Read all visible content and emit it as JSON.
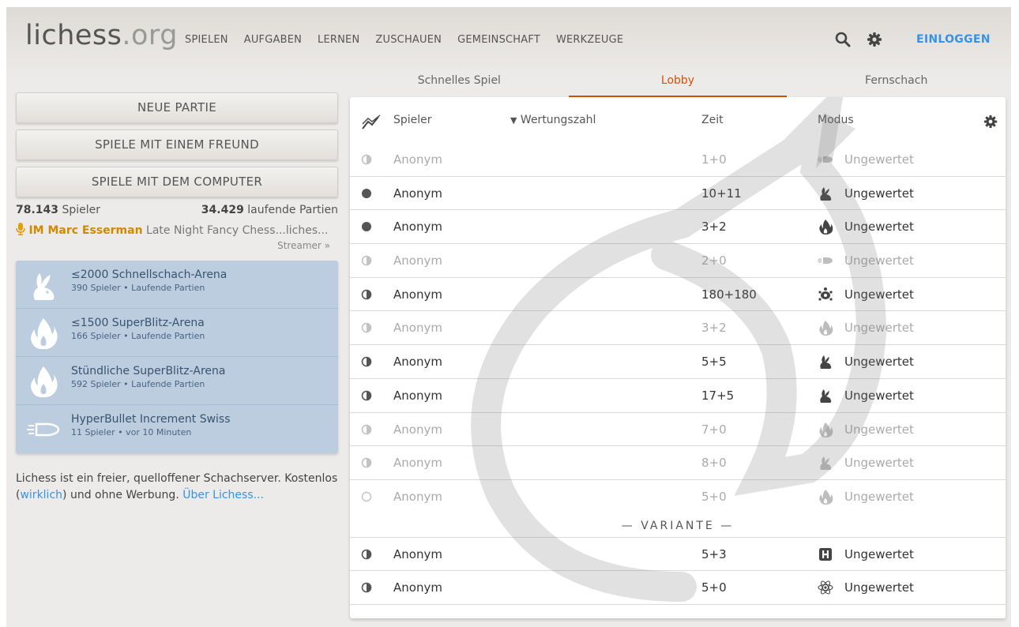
{
  "header": {
    "logo_main": "lichess",
    "logo_tld": ".org",
    "nav": [
      "SPIELEN",
      "AUFGABEN",
      "LERNEN",
      "ZUSCHAUEN",
      "GEMEINSCHAFT",
      "WERKZEUGE"
    ],
    "login": "EINLOGGEN",
    "accent_color": "#3692e7"
  },
  "tabs": [
    {
      "label": "Schnelles Spiel",
      "active": false
    },
    {
      "label": "Lobby",
      "active": true
    },
    {
      "label": "Fernschach",
      "active": false
    }
  ],
  "left": {
    "buttons": [
      "NEUE PARTIE",
      "SPIELE MIT EINEM FREUND",
      "SPIELE MIT DEM COMPUTER"
    ],
    "players_count": "78.143",
    "players_label": "Spieler",
    "games_count": "34.429",
    "games_label": "laufende Partien",
    "streamer_name": "IM Marc Esserman",
    "streamer_title": "Late Night Fancy Chess...liches...",
    "streamer_link": "Streamer »",
    "tournaments": [
      {
        "name": "≤2000 Schnellschach-Arena",
        "sub": "390 Spieler • Laufende Partien",
        "icon": "rabbit-icon"
      },
      {
        "name": "≤1500 SuperBlitz-Arena",
        "sub": "166 Spieler • Laufende Partien",
        "icon": "flame-icon"
      },
      {
        "name": "Stündliche SuperBlitz-Arena",
        "sub": "592 Spieler • Laufende Partien",
        "icon": "flame-icon"
      },
      {
        "name": "HyperBullet Increment Swiss",
        "sub": "11 Spieler •  vor 10 Minuten",
        "icon": "bullet-icon"
      }
    ],
    "about_text": "Lichess ist ein freier, quelloffener Schachserver. Kostenlos (",
    "about_link1": "wirklich",
    "about_text2": ") und ohne Werbung. ",
    "about_link2": "Über Lichess..."
  },
  "lobby": {
    "columns": {
      "player": "Spieler",
      "rating": "Wertungszahl",
      "time": "Zeit",
      "mode": "Modus"
    },
    "rows": [
      {
        "player": "Anonym",
        "time": "1+0",
        "mode": "Ungewertet",
        "dim": true,
        "dot": "half",
        "speed": "bullet-icon"
      },
      {
        "player": "Anonym",
        "time": "10+11",
        "mode": "Ungewertet",
        "dim": false,
        "dot": "full",
        "speed": "rabbit-icon"
      },
      {
        "player": "Anonym",
        "time": "3+2",
        "mode": "Ungewertet",
        "dim": false,
        "dot": "full",
        "speed": "flame-icon"
      },
      {
        "player": "Anonym",
        "time": "2+0",
        "mode": "Ungewertet",
        "dim": true,
        "dot": "half",
        "speed": "bullet-icon"
      },
      {
        "player": "Anonym",
        "time": "180+180",
        "mode": "Ungewertet",
        "dim": false,
        "dot": "half",
        "speed": "turtle-icon"
      },
      {
        "player": "Anonym",
        "time": "3+2",
        "mode": "Ungewertet",
        "dim": true,
        "dot": "half",
        "speed": "flame-icon"
      },
      {
        "player": "Anonym",
        "time": "5+5",
        "mode": "Ungewertet",
        "dim": false,
        "dot": "half",
        "speed": "rabbit-icon"
      },
      {
        "player": "Anonym",
        "time": "17+5",
        "mode": "Ungewertet",
        "dim": false,
        "dot": "half",
        "speed": "rabbit-icon"
      },
      {
        "player": "Anonym",
        "time": "7+0",
        "mode": "Ungewertet",
        "dim": true,
        "dot": "half",
        "speed": "flame-icon"
      },
      {
        "player": "Anonym",
        "time": "8+0",
        "mode": "Ungewertet",
        "dim": true,
        "dot": "half",
        "speed": "rabbit-icon"
      },
      {
        "player": "Anonym",
        "time": "5+0",
        "mode": "Ungewertet",
        "dim": true,
        "dot": "empty",
        "speed": "flame-icon"
      }
    ],
    "variant_label": "— VARIANTE —",
    "variant_rows": [
      {
        "player": "Anonym",
        "time": "5+3",
        "mode": "Ungewertet",
        "dim": false,
        "dot": "half",
        "speed": "horde-icon"
      },
      {
        "player": "Anonym",
        "time": "5+0",
        "mode": "Ungewertet",
        "dim": false,
        "dot": "half",
        "speed": "atomic-icon"
      }
    ]
  }
}
